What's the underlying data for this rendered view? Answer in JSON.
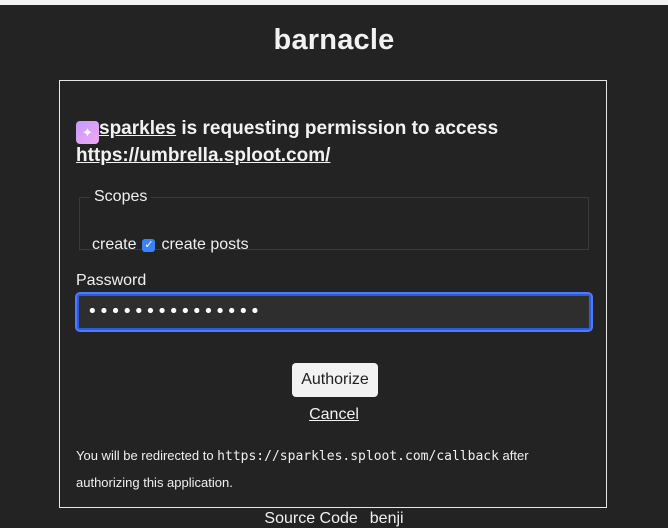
{
  "app": {
    "title": "barnacle"
  },
  "request": {
    "client_name": "sparkles",
    "middle_text": " is requesting permission to access ",
    "target_url": "https://umbrella.sploot.com/",
    "icon": "sparkles-icon"
  },
  "scopes": {
    "legend": "Scopes",
    "items": [
      {
        "name": "create",
        "checked": true,
        "label": "create posts"
      }
    ]
  },
  "password": {
    "label": "Password",
    "masked_value": "•••••••••••••••"
  },
  "actions": {
    "authorize_label": "Authorize",
    "cancel_label": "Cancel"
  },
  "redirect": {
    "prefix": "You will be redirected to ",
    "callback_url": "https://sparkles.sploot.com/callback",
    "suffix": " after authorizing this application."
  },
  "footer": {
    "source_code": "Source Code",
    "author": "benji"
  },
  "colors": {
    "background": "#232323",
    "focus_ring": "#4b7bff",
    "checkbox": "#3b82f6"
  }
}
